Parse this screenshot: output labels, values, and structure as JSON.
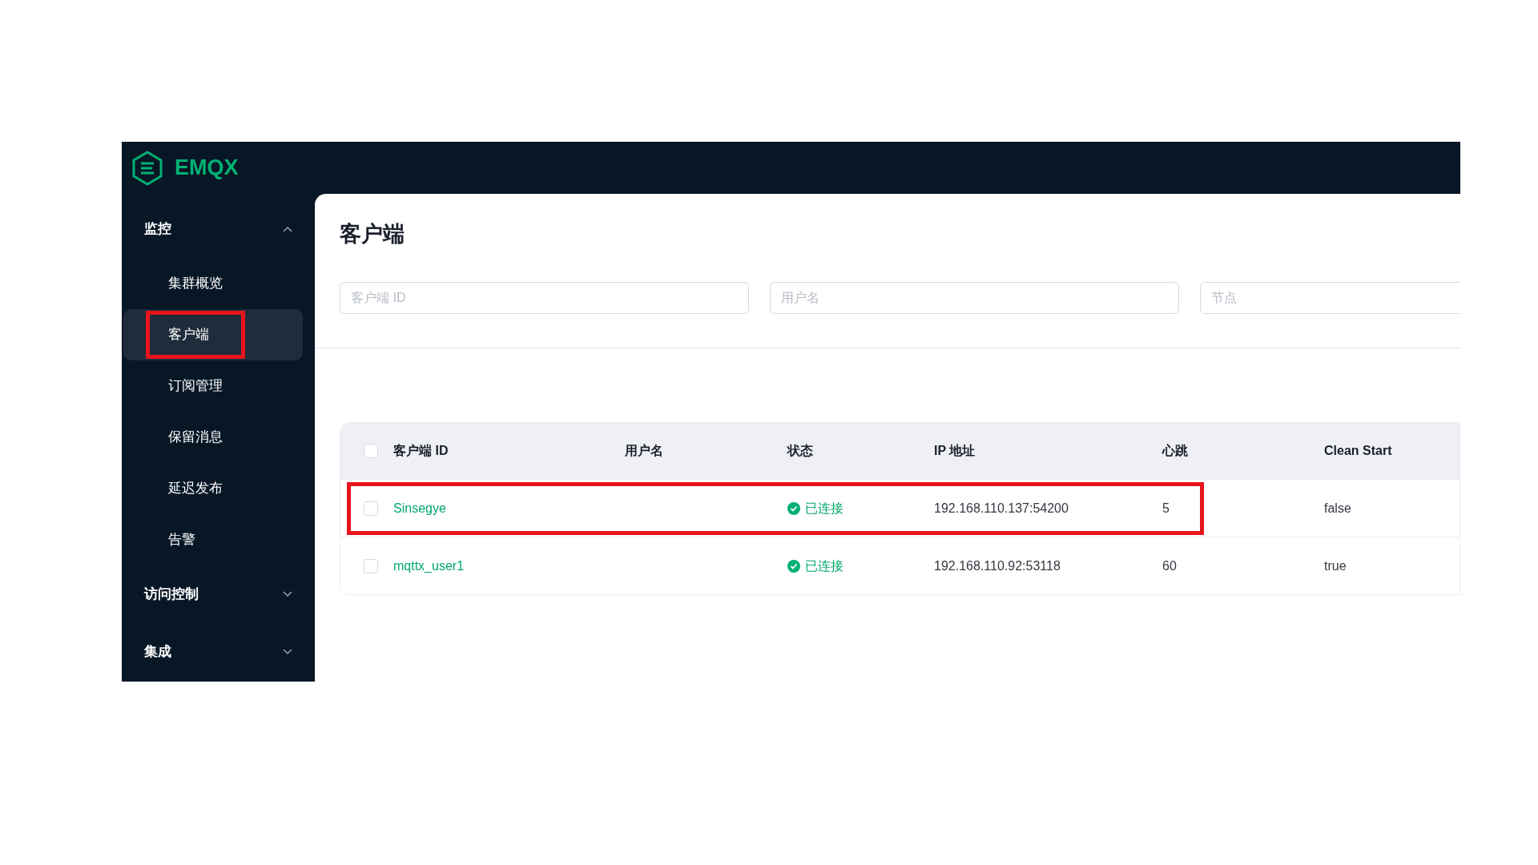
{
  "app": {
    "name": "EMQX"
  },
  "sidebar": {
    "groups": [
      {
        "label": "监控",
        "expanded": true,
        "items": [
          {
            "label": "集群概览",
            "selected": false,
            "highlighted": false
          },
          {
            "label": "客户端",
            "selected": true,
            "highlighted": true
          },
          {
            "label": "订阅管理",
            "selected": false,
            "highlighted": false
          },
          {
            "label": "保留消息",
            "selected": false,
            "highlighted": false
          },
          {
            "label": "延迟发布",
            "selected": false,
            "highlighted": false
          },
          {
            "label": "告警",
            "selected": false,
            "highlighted": false
          }
        ]
      },
      {
        "label": "访问控制",
        "expanded": false
      },
      {
        "label": "集成",
        "expanded": false
      }
    ]
  },
  "page_title": "客户端",
  "filters": [
    {
      "placeholder": "客户端 ID"
    },
    {
      "placeholder": "用户名"
    },
    {
      "placeholder": "节点"
    }
  ],
  "table": {
    "all_checked": false,
    "columns": [
      "客户端 ID",
      "用户名",
      "状态",
      "IP 地址",
      "心跳",
      "Clean Start"
    ],
    "rows": [
      {
        "checked": false,
        "highlighted": true,
        "client_id": "Sinsegye",
        "status": "已连接",
        "connected": true,
        "ip": "192.168.110.137:54200",
        "keepalive": "5",
        "clean_start": "false"
      },
      {
        "checked": false,
        "highlighted": false,
        "client_id": "mqttx_user1",
        "status": "已连接",
        "connected": true,
        "ip": "192.168.110.92:53118",
        "keepalive": "60",
        "clean_start": "true"
      }
    ]
  }
}
